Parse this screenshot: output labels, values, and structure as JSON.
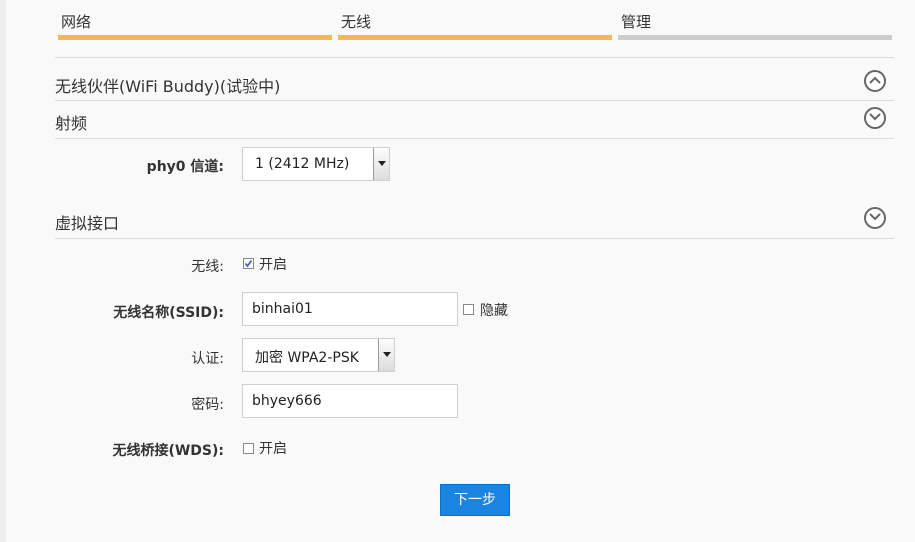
{
  "steps": [
    {
      "label": "网络",
      "color": "#f6b950"
    },
    {
      "label": "无线",
      "color": "#f6b950"
    },
    {
      "label": "管理",
      "color": "#cccccc"
    }
  ],
  "sections": {
    "wifi_buddy": {
      "title": "无线伙伴(WiFi Buddy)(试验中)",
      "icon": "chevron-up-circle-icon"
    },
    "radio": {
      "title": "射频",
      "icon": "chevron-down-circle-icon"
    },
    "virtual_iface": {
      "title": "虚拟接口",
      "icon": "chevron-down-circle-icon"
    }
  },
  "radio": {
    "channel_label": "phy0 信道:",
    "channel_value": "1 (2412 MHz)"
  },
  "iface": {
    "wireless_label": "无线:",
    "wireless_enable_label": "开启",
    "wireless_enabled": true,
    "ssid_label": "无线名称(SSID):",
    "ssid_value": "binhai01",
    "hide_label": "隐藏",
    "hide_checked": false,
    "auth_label": "认证:",
    "auth_value": "加密 WPA2-PSK",
    "password_label": "密码:",
    "password_value": "bhyey666",
    "wds_label": "无线桥接(WDS):",
    "wds_enable_label": "开启",
    "wds_enabled": false
  },
  "next_label": "下一步",
  "accent_color": "#1a84e0"
}
